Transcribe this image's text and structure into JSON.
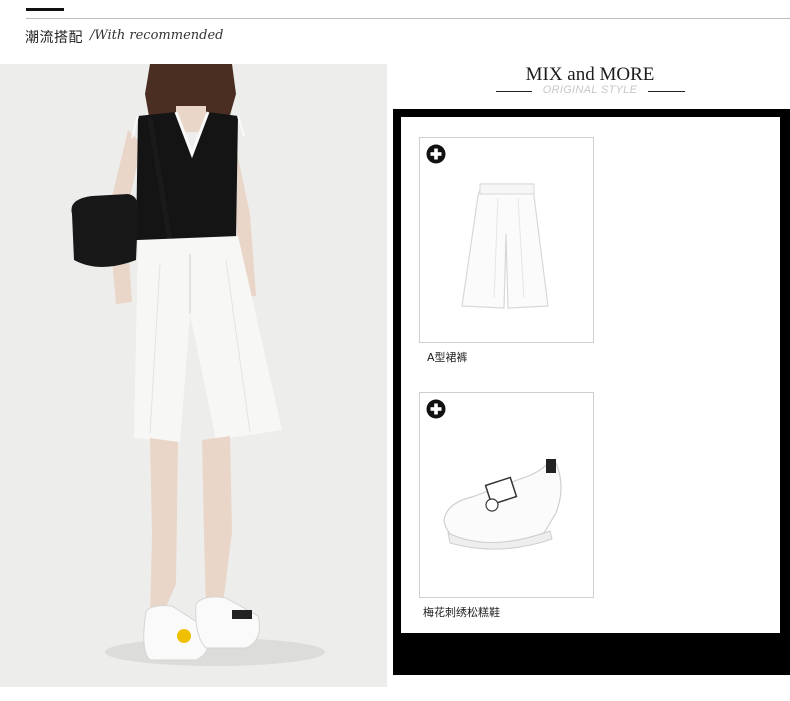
{
  "header": {
    "title": "潮流搭配",
    "subtitle": "/With recommended"
  },
  "mix": {
    "title": "MIX and MORE",
    "subtitle": "ORIGINAL STYLE"
  },
  "products": [
    {
      "name": "A型裙裤",
      "icon": "add-circle-icon"
    },
    {
      "name": "梅花刺绣松糕鞋",
      "icon": "add-circle-icon"
    }
  ],
  "colors": {
    "frame": "#000000",
    "background": "#ffffff",
    "subtitle_gray": "#c7c7c7"
  }
}
